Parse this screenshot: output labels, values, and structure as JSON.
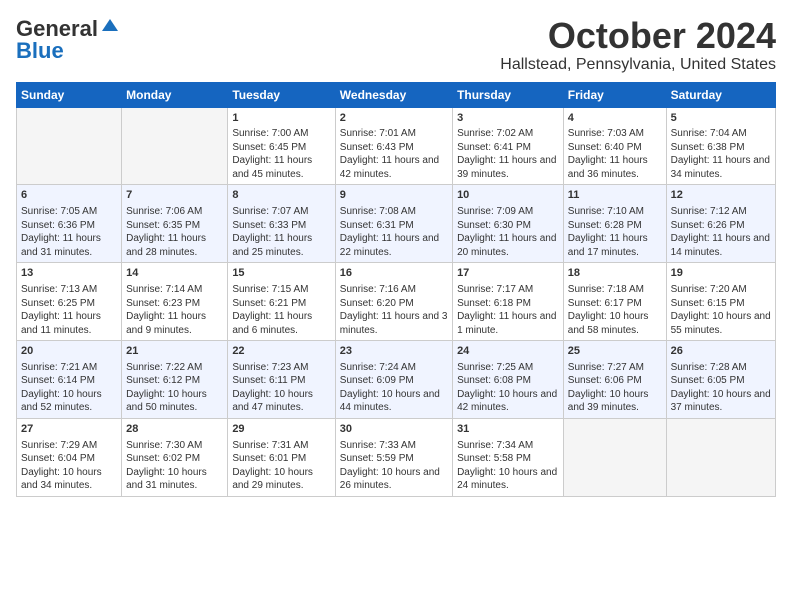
{
  "logo": {
    "line1": "General",
    "line2": "Blue"
  },
  "title": "October 2024",
  "subtitle": "Hallstead, Pennsylvania, United States",
  "days_of_week": [
    "Sunday",
    "Monday",
    "Tuesday",
    "Wednesday",
    "Thursday",
    "Friday",
    "Saturday"
  ],
  "weeks": [
    [
      {
        "num": "",
        "info": ""
      },
      {
        "num": "",
        "info": ""
      },
      {
        "num": "1",
        "info": "Sunrise: 7:00 AM\nSunset: 6:45 PM\nDaylight: 11 hours and 45 minutes."
      },
      {
        "num": "2",
        "info": "Sunrise: 7:01 AM\nSunset: 6:43 PM\nDaylight: 11 hours and 42 minutes."
      },
      {
        "num": "3",
        "info": "Sunrise: 7:02 AM\nSunset: 6:41 PM\nDaylight: 11 hours and 39 minutes."
      },
      {
        "num": "4",
        "info": "Sunrise: 7:03 AM\nSunset: 6:40 PM\nDaylight: 11 hours and 36 minutes."
      },
      {
        "num": "5",
        "info": "Sunrise: 7:04 AM\nSunset: 6:38 PM\nDaylight: 11 hours and 34 minutes."
      }
    ],
    [
      {
        "num": "6",
        "info": "Sunrise: 7:05 AM\nSunset: 6:36 PM\nDaylight: 11 hours and 31 minutes."
      },
      {
        "num": "7",
        "info": "Sunrise: 7:06 AM\nSunset: 6:35 PM\nDaylight: 11 hours and 28 minutes."
      },
      {
        "num": "8",
        "info": "Sunrise: 7:07 AM\nSunset: 6:33 PM\nDaylight: 11 hours and 25 minutes."
      },
      {
        "num": "9",
        "info": "Sunrise: 7:08 AM\nSunset: 6:31 PM\nDaylight: 11 hours and 22 minutes."
      },
      {
        "num": "10",
        "info": "Sunrise: 7:09 AM\nSunset: 6:30 PM\nDaylight: 11 hours and 20 minutes."
      },
      {
        "num": "11",
        "info": "Sunrise: 7:10 AM\nSunset: 6:28 PM\nDaylight: 11 hours and 17 minutes."
      },
      {
        "num": "12",
        "info": "Sunrise: 7:12 AM\nSunset: 6:26 PM\nDaylight: 11 hours and 14 minutes."
      }
    ],
    [
      {
        "num": "13",
        "info": "Sunrise: 7:13 AM\nSunset: 6:25 PM\nDaylight: 11 hours and 11 minutes."
      },
      {
        "num": "14",
        "info": "Sunrise: 7:14 AM\nSunset: 6:23 PM\nDaylight: 11 hours and 9 minutes."
      },
      {
        "num": "15",
        "info": "Sunrise: 7:15 AM\nSunset: 6:21 PM\nDaylight: 11 hours and 6 minutes."
      },
      {
        "num": "16",
        "info": "Sunrise: 7:16 AM\nSunset: 6:20 PM\nDaylight: 11 hours and 3 minutes."
      },
      {
        "num": "17",
        "info": "Sunrise: 7:17 AM\nSunset: 6:18 PM\nDaylight: 11 hours and 1 minute."
      },
      {
        "num": "18",
        "info": "Sunrise: 7:18 AM\nSunset: 6:17 PM\nDaylight: 10 hours and 58 minutes."
      },
      {
        "num": "19",
        "info": "Sunrise: 7:20 AM\nSunset: 6:15 PM\nDaylight: 10 hours and 55 minutes."
      }
    ],
    [
      {
        "num": "20",
        "info": "Sunrise: 7:21 AM\nSunset: 6:14 PM\nDaylight: 10 hours and 52 minutes."
      },
      {
        "num": "21",
        "info": "Sunrise: 7:22 AM\nSunset: 6:12 PM\nDaylight: 10 hours and 50 minutes."
      },
      {
        "num": "22",
        "info": "Sunrise: 7:23 AM\nSunset: 6:11 PM\nDaylight: 10 hours and 47 minutes."
      },
      {
        "num": "23",
        "info": "Sunrise: 7:24 AM\nSunset: 6:09 PM\nDaylight: 10 hours and 44 minutes."
      },
      {
        "num": "24",
        "info": "Sunrise: 7:25 AM\nSunset: 6:08 PM\nDaylight: 10 hours and 42 minutes."
      },
      {
        "num": "25",
        "info": "Sunrise: 7:27 AM\nSunset: 6:06 PM\nDaylight: 10 hours and 39 minutes."
      },
      {
        "num": "26",
        "info": "Sunrise: 7:28 AM\nSunset: 6:05 PM\nDaylight: 10 hours and 37 minutes."
      }
    ],
    [
      {
        "num": "27",
        "info": "Sunrise: 7:29 AM\nSunset: 6:04 PM\nDaylight: 10 hours and 34 minutes."
      },
      {
        "num": "28",
        "info": "Sunrise: 7:30 AM\nSunset: 6:02 PM\nDaylight: 10 hours and 31 minutes."
      },
      {
        "num": "29",
        "info": "Sunrise: 7:31 AM\nSunset: 6:01 PM\nDaylight: 10 hours and 29 minutes."
      },
      {
        "num": "30",
        "info": "Sunrise: 7:33 AM\nSunset: 5:59 PM\nDaylight: 10 hours and 26 minutes."
      },
      {
        "num": "31",
        "info": "Sunrise: 7:34 AM\nSunset: 5:58 PM\nDaylight: 10 hours and 24 minutes."
      },
      {
        "num": "",
        "info": ""
      },
      {
        "num": "",
        "info": ""
      }
    ]
  ]
}
